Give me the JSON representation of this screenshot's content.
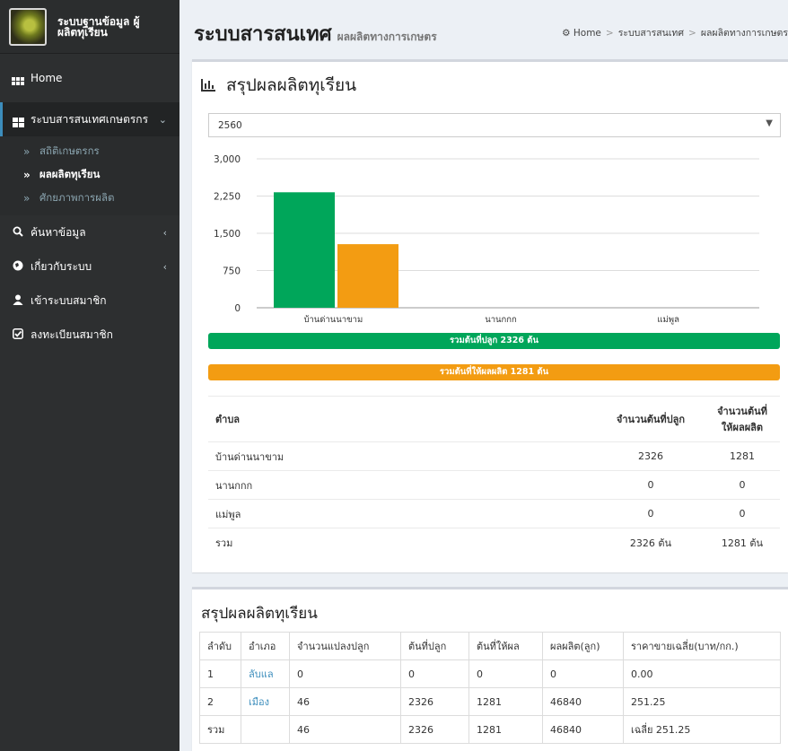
{
  "sidebar": {
    "brand_text": "ระบบฐานข้อมูล ผู้ผลิตทุเรียน",
    "items": [
      {
        "label": "Home",
        "icon": "grid-icon"
      },
      {
        "label": "ระบบสารสนเทศเกษตรกร",
        "icon": "dashboard-icon",
        "chevron": "⌄"
      },
      {
        "label": "ค้นหาข้อมูล",
        "icon": "search-icon",
        "chevron": "‹"
      },
      {
        "label": "เกี่ยวกับระบบ",
        "icon": "globe-icon",
        "chevron": "‹"
      },
      {
        "label": "เข้าระบบสมาชิก",
        "icon": "user-icon"
      },
      {
        "label": "ลงทะเบียนสมาชิก",
        "icon": "check-square-icon"
      }
    ],
    "submenu": [
      {
        "label": "สถิติเกษตรกร"
      },
      {
        "label": "ผลผลิตทุเรียน"
      },
      {
        "label": "ศักยภาพการผลิต"
      }
    ]
  },
  "header": {
    "title": "ระบบสารสนเทศ",
    "subtitle": "ผลผลิตทางการเกษตร",
    "breadcrumb": [
      "Home",
      "ระบบสารสนเทศ",
      "ผลผลิตทางการเกษตร"
    ]
  },
  "summary_box": {
    "title": "สรุปผลผลิตทุเรียน",
    "year_select": "2560",
    "total_planted_label": "รวมต้นที่ปลูก 2326 ต้น",
    "total_yield_label": "รวมต้นที่ให้ผลผลิต 1281 ต้น",
    "table": {
      "headers": [
        "ตำบล",
        "จำนวนต้นที่ปลูก",
        "จำนวนต้นที่ให้ผลผลิต"
      ],
      "rows": [
        [
          "บ้านด่านนาขาม",
          "2326",
          "1281"
        ],
        [
          "นานกกก",
          "0",
          "0"
        ],
        [
          "แม่พูล",
          "0",
          "0"
        ],
        [
          "รวม",
          "2326 ต้น",
          "1281 ต้น"
        ]
      ]
    }
  },
  "chart_data": {
    "type": "bar",
    "categories": [
      "บ้านด่านนาขาม",
      "นานกกก",
      "แม่พูล"
    ],
    "series": [
      {
        "values": [
          2326,
          0,
          0
        ],
        "color": "#00a65a"
      },
      {
        "values": [
          1281,
          0,
          0
        ],
        "color": "#f39c12"
      }
    ],
    "ylim": [
      0,
      3000
    ],
    "yticks": [
      "0",
      "750",
      "1,500",
      "2,250",
      "3,000"
    ],
    "grid": true
  },
  "district_box": {
    "title": "สรุปผลผลิตทุเรียน",
    "headers": [
      "ลำดับ",
      "อำเภอ",
      "จำนวนแปลงปลูก",
      "ต้นที่ปลูก",
      "ต้นที่ให้ผล",
      "ผลผลิต(ลูก)",
      "ราคาขายเฉลี่ย(บาท/กก.)"
    ],
    "rows": [
      [
        "1",
        "ลับแล",
        "0",
        "0",
        "0",
        "0",
        "0.00"
      ],
      [
        "2",
        "เมือง",
        "46",
        "2326",
        "1281",
        "46840",
        "251.25"
      ],
      [
        "รวม",
        "",
        "46",
        "2326",
        "1281",
        "46840",
        "เฉลี่ย 251.25"
      ]
    ]
  },
  "colors": {
    "green": "#00a65a",
    "orange": "#f39c12",
    "link": "#3c8dbc",
    "sidebar": "#2d2f30"
  }
}
